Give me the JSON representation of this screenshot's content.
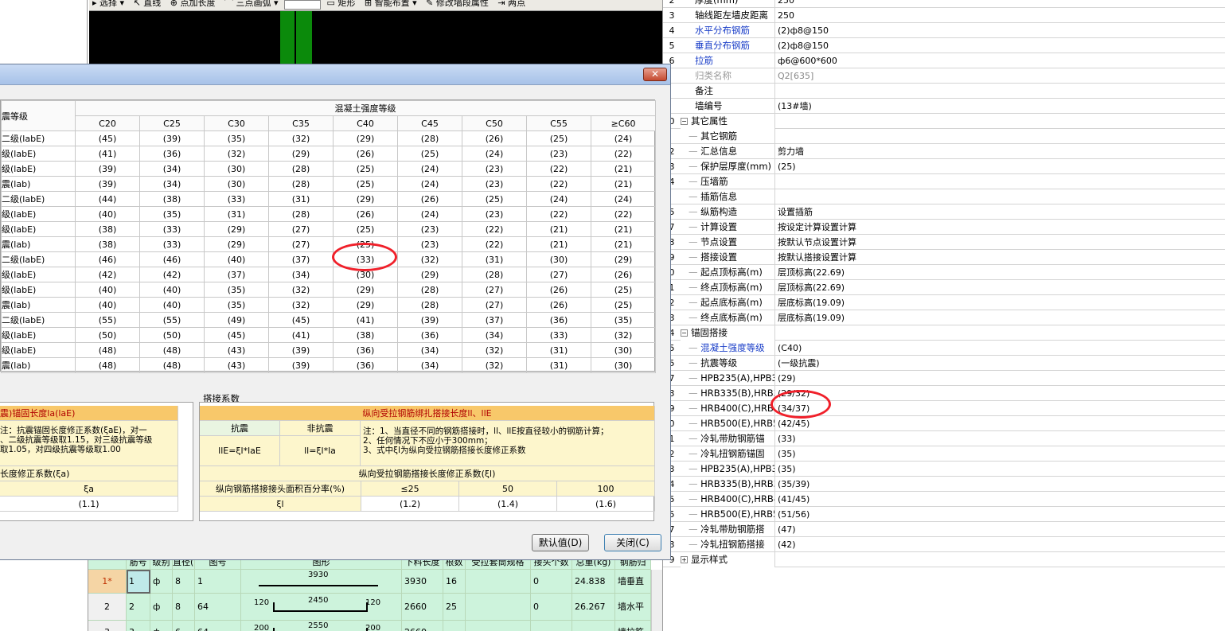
{
  "toolbar": {
    "items": [
      "选择",
      "直线",
      "点加长度",
      "三点画弧",
      "矩形",
      "智能布置",
      "修改墙段属性",
      "两点"
    ]
  },
  "properties": {
    "rows": [
      {
        "num": "2",
        "name": "厚度(mm)",
        "value": "250",
        "style": "normal"
      },
      {
        "num": "3",
        "name": "轴线距左墙皮距离",
        "value": "250",
        "style": "normal"
      },
      {
        "num": "4",
        "name": "水平分布钢筋",
        "value": "(2)ф8@150",
        "style": "blue"
      },
      {
        "num": "5",
        "name": "垂直分布钢筋",
        "value": "(2)ф8@150",
        "style": "blue"
      },
      {
        "num": "6",
        "name": "拉筋",
        "value": "ф6@600*600",
        "style": "blue"
      },
      {
        "num": "",
        "name": "归类名称",
        "value": "Q2[635]",
        "style": "gray"
      },
      {
        "num": "",
        "name": "备注",
        "value": "",
        "style": "normal"
      },
      {
        "num": "",
        "name": "墙编号",
        "value": "(13#墙)",
        "style": "normal"
      },
      {
        "num": "0",
        "name": "其它属性",
        "value": "",
        "style": "group"
      },
      {
        "num": "",
        "name": "其它钢筋",
        "value": "",
        "style": "child"
      },
      {
        "num": "2",
        "name": "汇总信息",
        "value": "剪力墙",
        "style": "child"
      },
      {
        "num": "3",
        "name": "保护层厚度(mm)",
        "value": "(25)",
        "style": "child"
      },
      {
        "num": "4",
        "name": "压墙筋",
        "value": "",
        "style": "child"
      },
      {
        "num": "",
        "name": "插筋信息",
        "value": "",
        "style": "child"
      },
      {
        "num": "5",
        "name": "纵筋构造",
        "value": "设置插筋",
        "style": "child"
      },
      {
        "num": "7",
        "name": "计算设置",
        "value": "按设定计算设置计算",
        "style": "child"
      },
      {
        "num": "3",
        "name": "节点设置",
        "value": "按默认节点设置计算",
        "style": "child"
      },
      {
        "num": "9",
        "name": "搭接设置",
        "value": "按默认搭接设置计算",
        "style": "child"
      },
      {
        "num": "0",
        "name": "起点顶标高(m)",
        "value": "层顶标高(22.69)",
        "style": "child"
      },
      {
        "num": "1",
        "name": "终点顶标高(m)",
        "value": "层顶标高(22.69)",
        "style": "child"
      },
      {
        "num": "2",
        "name": "起点底标高(m)",
        "value": "层底标高(19.09)",
        "style": "child"
      },
      {
        "num": "3",
        "name": "终点底标高(m)",
        "value": "层底标高(19.09)",
        "style": "child"
      },
      {
        "num": "4",
        "name": "锚固搭接",
        "value": "",
        "style": "group"
      },
      {
        "num": "5",
        "name": "混凝土强度等级",
        "value": "(C40)",
        "style": "childblue"
      },
      {
        "num": "5",
        "name": "抗震等级",
        "value": "(一级抗震)",
        "style": "child"
      },
      {
        "num": "7",
        "name": "HPB235(A),HPB3",
        "value": "(29)",
        "style": "child"
      },
      {
        "num": "3",
        "name": "HRB335(B),HRB3",
        "value": "(29/32)",
        "style": "child"
      },
      {
        "num": "9",
        "name": "HRB400(C),HRB",
        "value": "(34/37)",
        "style": "child"
      },
      {
        "num": "0",
        "name": "HRB500(E),HRB5",
        "value": "(42/45)",
        "style": "child"
      },
      {
        "num": "1",
        "name": "冷轧带肋钢筋锚",
        "value": "(33)",
        "style": "child"
      },
      {
        "num": "2",
        "name": "冷轧扭钢筋锚固",
        "value": "(35)",
        "style": "child"
      },
      {
        "num": "3",
        "name": "HPB235(A),HPB3",
        "value": "(35)",
        "style": "child"
      },
      {
        "num": "4",
        "name": "HRB335(B),HRB3",
        "value": "(35/39)",
        "style": "child"
      },
      {
        "num": "5",
        "name": "HRB400(C),HRB4",
        "value": "(41/45)",
        "style": "child"
      },
      {
        "num": "5",
        "name": "HRB500(E),HRB5",
        "value": "(51/56)",
        "style": "child"
      },
      {
        "num": "7",
        "name": "冷轧带肋钢筋搭",
        "value": "(47)",
        "style": "child"
      },
      {
        "num": "3",
        "name": "冷轧扭钢筋搭接",
        "value": "(42)",
        "style": "child"
      },
      {
        "num": "9",
        "name": "显示样式",
        "value": "",
        "style": "groupplus"
      }
    ]
  },
  "dialog": {
    "close_symbol": "✕",
    "seismic_header": "震等级",
    "concrete_header": "混凝土强度等级",
    "grades": [
      "C20",
      "C25",
      "C30",
      "C35",
      "C40",
      "C45",
      "C50",
      "C55",
      "≥C60"
    ],
    "rows": [
      {
        "label": "二级(labE)",
        "values": [
          "(45)",
          "(39)",
          "(35)",
          "(32)",
          "(29)",
          "(28)",
          "(26)",
          "(25)",
          "(24)"
        ]
      },
      {
        "label": "级(labE)",
        "values": [
          "(41)",
          "(36)",
          "(32)",
          "(29)",
          "(26)",
          "(25)",
          "(24)",
          "(23)",
          "(22)"
        ]
      },
      {
        "label": "级(labE)",
        "values": [
          "(39)",
          "(34)",
          "(30)",
          "(28)",
          "(25)",
          "(24)",
          "(23)",
          "(22)",
          "(21)"
        ]
      },
      {
        "label": "震(lab)",
        "values": [
          "(39)",
          "(34)",
          "(30)",
          "(28)",
          "(25)",
          "(24)",
          "(23)",
          "(22)",
          "(21)"
        ]
      },
      {
        "label": "二级(labE)",
        "values": [
          "(44)",
          "(38)",
          "(33)",
          "(31)",
          "(29)",
          "(26)",
          "(25)",
          "(24)",
          "(24)"
        ]
      },
      {
        "label": "级(labE)",
        "values": [
          "(40)",
          "(35)",
          "(31)",
          "(28)",
          "(26)",
          "(24)",
          "(23)",
          "(22)",
          "(22)"
        ]
      },
      {
        "label": "级(labE)",
        "values": [
          "(38)",
          "(33)",
          "(29)",
          "(27)",
          "(25)",
          "(23)",
          "(22)",
          "(21)",
          "(21)"
        ]
      },
      {
        "label": "震(lab)",
        "values": [
          "(38)",
          "(33)",
          "(29)",
          "(27)",
          "(25)",
          "(23)",
          "(22)",
          "(21)",
          "(21)"
        ]
      },
      {
        "label": "二级(labE)",
        "values": [
          "(46)",
          "(46)",
          "(40)",
          "(37)",
          "(33)",
          "(32)",
          "(31)",
          "(30)",
          "(29)"
        ]
      },
      {
        "label": "级(labE)",
        "values": [
          "(42)",
          "(42)",
          "(37)",
          "(34)",
          "(30)",
          "(29)",
          "(28)",
          "(27)",
          "(26)"
        ]
      },
      {
        "label": "级(labE)",
        "values": [
          "(40)",
          "(40)",
          "(35)",
          "(32)",
          "(29)",
          "(28)",
          "(27)",
          "(26)",
          "(25)"
        ]
      },
      {
        "label": "震(lab)",
        "values": [
          "(40)",
          "(40)",
          "(35)",
          "(32)",
          "(29)",
          "(28)",
          "(27)",
          "(26)",
          "(25)"
        ]
      },
      {
        "label": "二级(labE)",
        "values": [
          "(55)",
          "(55)",
          "(49)",
          "(45)",
          "(41)",
          "(39)",
          "(37)",
          "(36)",
          "(35)"
        ]
      },
      {
        "label": "级(labE)",
        "values": [
          "(50)",
          "(50)",
          "(45)",
          "(41)",
          "(38)",
          "(36)",
          "(34)",
          "(33)",
          "(32)"
        ]
      },
      {
        "label": "级(labE)",
        "values": [
          "(48)",
          "(48)",
          "(43)",
          "(39)",
          "(36)",
          "(34)",
          "(32)",
          "(31)",
          "(30)"
        ]
      },
      {
        "label": "震(lab)",
        "values": [
          "(48)",
          "(48)",
          "(43)",
          "(39)",
          "(36)",
          "(34)",
          "(32)",
          "(31)",
          "(30)"
        ]
      }
    ],
    "anchor_section": {
      "title": "震)锚固长度la(laE)",
      "note1": "注：抗震锚固长度修正系数(ξaE)，对一",
      "note2": "、二级抗震等级取1.15，对三级抗震等级",
      "note3": "取1.05，对四级抗震等级取1.00",
      "factor_label": "长度修正系数(ξa)",
      "factor_symbol": "ξa",
      "factor_value": "(1.1)"
    },
    "lap_caption": "搭接系数",
    "lap_section": {
      "title": "纵向受拉钢筋绑扎搭接长度ll、llE",
      "seismic": "抗震",
      "nonseismic": "非抗震",
      "formula_seismic": "llE=ξl*laE",
      "formula_nonseismic": "ll=ξl*la",
      "note1": "注：1、当直径不同的钢筋搭接时，ll、llE按直径较小的钢筋计算；",
      "note2": "2、任何情况下不应小于300mm；",
      "note3": "3、式中ξl为纵向受拉钢筋搭接长度修正系数",
      "factor_title": "纵向受拉钢筋搭接长度修正系数(ξl)",
      "pct_label": "纵向钢筋搭接接头面积百分率(%)",
      "pct_values": [
        "≤25",
        "50",
        "100"
      ],
      "xi_label": "ξl",
      "xi_values": [
        "(1.2)",
        "(1.4)",
        "(1.6)"
      ]
    },
    "default_button": "默认值(D)",
    "close_button": "关闭(C)"
  },
  "rebar_grid": {
    "headers": [
      "筋号",
      "级别",
      "直径(mm)",
      "图号",
      "图形",
      "下料长度",
      "根数",
      "受拉套筒规格",
      "接头个数",
      "总重(kg)",
      "钢筋归"
    ],
    "rows": [
      {
        "idx": "1*",
        "no": "1",
        "grade": "ф",
        "dia": "8",
        "fig": "1",
        "shape_left": "",
        "shape_mid": "3930",
        "shape_right": "",
        "length": "3930",
        "count": "16",
        "sleeve": "",
        "joints": "0",
        "weight": "24.838",
        "type": "墙垂直"
      },
      {
        "idx": "2",
        "no": "2",
        "grade": "ф",
        "dia": "8",
        "fig": "64",
        "shape_left": "120",
        "shape_mid": "2450",
        "shape_right": "120",
        "length": "2660",
        "count": "25",
        "sleeve": "",
        "joints": "0",
        "weight": "26.267",
        "type": "墙水平"
      },
      {
        "idx": "3",
        "no": "3",
        "grade": "ф",
        "dia": "6",
        "fig": "64",
        "shape_left": "200",
        "shape_mid": "2550",
        "shape_right": "200",
        "length": "2660",
        "count": "",
        "sleeve": "",
        "joints": "",
        "weight": "",
        "type": "墙拉筋"
      }
    ]
  }
}
